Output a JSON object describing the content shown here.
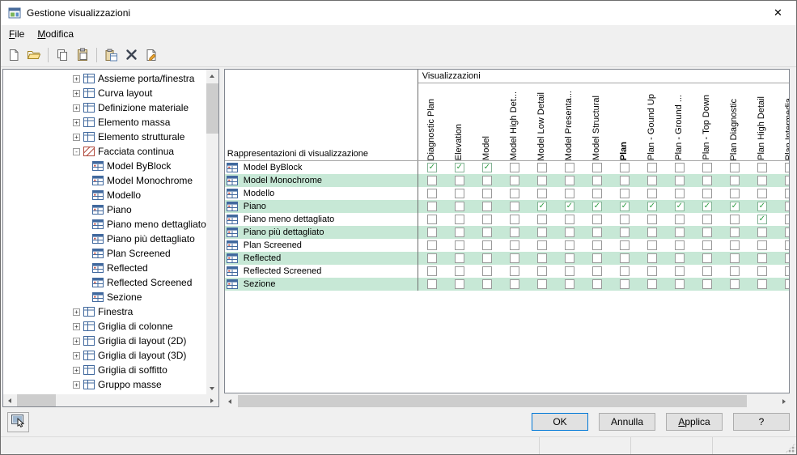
{
  "window": {
    "title": "Gestione visualizzazioni",
    "close_glyph": "✕"
  },
  "menubar": {
    "items": [
      {
        "accel": "F",
        "rest": "ile"
      },
      {
        "accel": "M",
        "rest": "odifica"
      }
    ]
  },
  "toolbar": {
    "items": [
      {
        "icon": "new-file"
      },
      {
        "icon": "open-folder"
      },
      {
        "separator": true
      },
      {
        "icon": "copy"
      },
      {
        "icon": "paste"
      },
      {
        "separator": true
      },
      {
        "icon": "paste-as-new"
      },
      {
        "icon": "delete"
      },
      {
        "icon": "page-edit"
      }
    ]
  },
  "tree": {
    "items": [
      {
        "label": "Assieme porta/finestra",
        "depth": 2,
        "expander": "+",
        "icon": "door-window-assembly-icon"
      },
      {
        "label": "Curva layout",
        "depth": 2,
        "expander": "+",
        "icon": "layout-curve-icon"
      },
      {
        "label": "Definizione materiale",
        "depth": 2,
        "expander": "+",
        "icon": "material-definition-icon"
      },
      {
        "label": "Elemento massa",
        "depth": 2,
        "expander": "+",
        "icon": "mass-element-icon"
      },
      {
        "label": "Elemento strutturale",
        "depth": 2,
        "expander": "+",
        "icon": "structural-member-icon"
      },
      {
        "label": "Facciata continua",
        "depth": 2,
        "expander": "-",
        "icon": "curtain-wall-icon"
      },
      {
        "label": "Model ByBlock",
        "depth": 3,
        "expander": "",
        "icon": "display-rep-icon"
      },
      {
        "label": "Model Monochrome",
        "depth": 3,
        "expander": "",
        "icon": "display-rep-icon"
      },
      {
        "label": "Modello",
        "depth": 3,
        "expander": "",
        "icon": "display-rep-icon"
      },
      {
        "label": "Piano",
        "depth": 3,
        "expander": "",
        "icon": "display-rep-icon"
      },
      {
        "label": "Piano meno dettagliato",
        "depth": 3,
        "expander": "",
        "icon": "display-rep-icon"
      },
      {
        "label": "Piano più dettagliato",
        "depth": 3,
        "expander": "",
        "icon": "display-rep-icon"
      },
      {
        "label": "Plan Screened",
        "depth": 3,
        "expander": "",
        "icon": "display-rep-icon"
      },
      {
        "label": "Reflected",
        "depth": 3,
        "expander": "",
        "icon": "display-rep-icon"
      },
      {
        "label": "Reflected Screened",
        "depth": 3,
        "expander": "",
        "icon": "display-rep-icon"
      },
      {
        "label": "Sezione",
        "depth": 3,
        "expander": "",
        "icon": "display-rep-icon"
      },
      {
        "label": "Finestra",
        "depth": 2,
        "expander": "+",
        "icon": "window-icon"
      },
      {
        "label": "Griglia di colonne",
        "depth": 2,
        "expander": "+",
        "icon": "column-grid-icon"
      },
      {
        "label": "Griglia di layout (2D)",
        "depth": 2,
        "expander": "+",
        "icon": "layout-grid-2d-icon"
      },
      {
        "label": "Griglia di layout (3D)",
        "depth": 2,
        "expander": "+",
        "icon": "layout-grid-3d-icon"
      },
      {
        "label": "Griglia di soffitto",
        "depth": 2,
        "expander": "+",
        "icon": "ceiling-grid-icon"
      },
      {
        "label": "Gruppo masse",
        "depth": 2,
        "expander": "+",
        "icon": "mass-group-icon"
      }
    ]
  },
  "table": {
    "group_header": "Visualizzazioni",
    "row_header": "Rappresentazioni di visualizzazione",
    "columns": [
      {
        "label": "Diagnostic Plan"
      },
      {
        "label": "Elevation"
      },
      {
        "label": "Model"
      },
      {
        "label": "Model High Det..."
      },
      {
        "label": "Model Low Detail"
      },
      {
        "label": "Model Presenta..."
      },
      {
        "label": "Model Structural"
      },
      {
        "label": "Plan",
        "bold": true
      },
      {
        "label": "Plan - Gound Up"
      },
      {
        "label": "Plan - Ground ..."
      },
      {
        "label": "Plan - Top Down"
      },
      {
        "label": "Plan Diagnostic"
      },
      {
        "label": "Plan High Detail"
      },
      {
        "label": "Plan Intermedia..."
      }
    ],
    "rows": [
      {
        "label": "Model ByBlock",
        "checks": [
          1,
          1,
          1,
          0,
          0,
          0,
          0,
          0,
          0,
          0,
          0,
          0,
          0,
          0
        ]
      },
      {
        "label": "Model Monochrome",
        "checks": [
          0,
          0,
          0,
          0,
          0,
          0,
          0,
          0,
          0,
          0,
          0,
          0,
          0,
          0
        ]
      },
      {
        "label": "Modello",
        "checks": [
          0,
          0,
          0,
          0,
          0,
          0,
          0,
          0,
          0,
          0,
          0,
          0,
          0,
          0
        ]
      },
      {
        "label": "Piano",
        "checks": [
          0,
          0,
          0,
          0,
          1,
          1,
          1,
          1,
          1,
          1,
          1,
          1,
          1,
          0
        ]
      },
      {
        "label": "Piano meno dettagliato",
        "checks": [
          0,
          0,
          0,
          0,
          0,
          0,
          0,
          0,
          0,
          0,
          0,
          0,
          1,
          0
        ]
      },
      {
        "label": "Piano più dettagliato",
        "checks": [
          0,
          0,
          0,
          0,
          0,
          0,
          0,
          0,
          0,
          0,
          0,
          0,
          0,
          0
        ]
      },
      {
        "label": "Plan Screened",
        "checks": [
          0,
          0,
          0,
          0,
          0,
          0,
          0,
          0,
          0,
          0,
          0,
          0,
          0,
          0
        ]
      },
      {
        "label": "Reflected",
        "checks": [
          0,
          0,
          0,
          0,
          0,
          0,
          0,
          0,
          0,
          0,
          0,
          0,
          0,
          0
        ]
      },
      {
        "label": "Reflected Screened",
        "checks": [
          0,
          0,
          0,
          0,
          0,
          0,
          0,
          0,
          0,
          0,
          0,
          0,
          0,
          0
        ]
      },
      {
        "label": "Sezione",
        "checks": [
          0,
          0,
          0,
          0,
          0,
          0,
          0,
          0,
          0,
          0,
          0,
          0,
          0,
          0
        ]
      }
    ],
    "colors": {
      "row_tint": "#c7e8d6",
      "check_green": "#2f9e44"
    }
  },
  "footer": {
    "ok_label": "OK",
    "cancel_label": "Annulla",
    "apply_accel": "A",
    "apply_rest": "pplica",
    "help_label": "?"
  },
  "statusbar": {
    "segments": [
      "",
      "",
      ""
    ]
  }
}
